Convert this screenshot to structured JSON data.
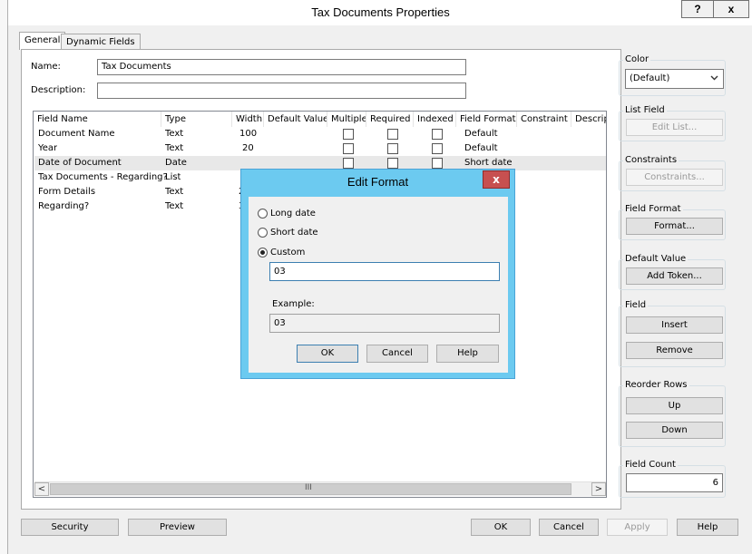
{
  "window": {
    "title": "Tax Documents Properties",
    "help_label": "?",
    "close_label": "x"
  },
  "tabs": [
    {
      "label": "General"
    },
    {
      "label": "Dynamic Fields"
    }
  ],
  "form": {
    "name_label": "Name:",
    "name_value": "Tax Documents",
    "description_label": "Description:",
    "description_value": ""
  },
  "table": {
    "headers": [
      "Field Name",
      "Type",
      "Width",
      "Default Value",
      "Multiple",
      "Required",
      "Indexed",
      "Field Format",
      "Constraint",
      "Descrip"
    ],
    "rows": [
      {
        "name": "Document Name",
        "type": "Text",
        "width": "100",
        "format": "Default"
      },
      {
        "name": "Year",
        "type": "Text",
        "width": "20",
        "format": "Default"
      },
      {
        "name": "Date of Document",
        "type": "Date",
        "width": "",
        "format": "Short date"
      },
      {
        "name": "Tax Documents - Regarding?",
        "type": "List",
        "width": "",
        "format": ""
      },
      {
        "name": "Form Details",
        "type": "Text",
        "width": "2",
        "format": ""
      },
      {
        "name": "Regarding?",
        "type": "Text",
        "width": "3",
        "format": ""
      }
    ],
    "scroll_grip": "III",
    "scroll_left": "<",
    "scroll_right": ">"
  },
  "right_panel": {
    "color": {
      "label": "Color",
      "value": "(Default)"
    },
    "list_field": {
      "label": "List Field",
      "button": "Edit List..."
    },
    "constraints": {
      "label": "Constraints",
      "button": "Constraints..."
    },
    "field_format": {
      "label": "Field Format",
      "button": "Format..."
    },
    "default_value": {
      "label": "Default Value",
      "button": "Add Token..."
    },
    "field": {
      "label": "Field",
      "insert": "Insert",
      "remove": "Remove"
    },
    "reorder": {
      "label": "Reorder Rows",
      "up": "Up",
      "down": "Down"
    },
    "field_count": {
      "label": "Field Count",
      "value": "6"
    }
  },
  "dialog": {
    "title": "Edit Format",
    "close_label": "x",
    "options": [
      "Long date",
      "Short date",
      "Custom"
    ],
    "selected": "Custom",
    "custom_value": "03",
    "example_label": "Example:",
    "example_value": "03",
    "ok": "OK",
    "cancel": "Cancel",
    "help": "Help"
  },
  "footer": {
    "security": "Security",
    "preview": "Preview",
    "ok": "OK",
    "cancel": "Cancel",
    "apply": "Apply",
    "help": "Help"
  }
}
